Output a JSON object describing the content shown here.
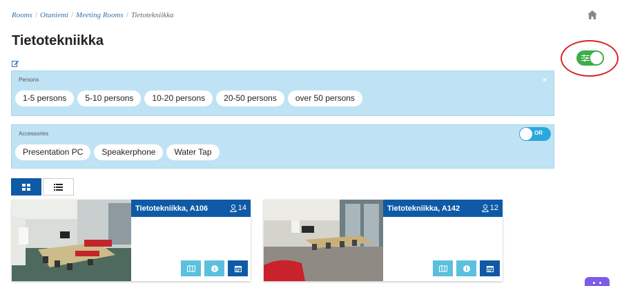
{
  "breadcrumb": {
    "items": [
      "Rooms",
      "Otaniemi",
      "Meeting Rooms"
    ],
    "current": "Tietotekniikka"
  },
  "page": {
    "title": "Tietotekniikka"
  },
  "filters": {
    "persons": {
      "label": "Persons",
      "close": "×",
      "options": [
        "1-5 persons",
        "5-10 persons",
        "10-20 persons",
        "20-50 persons",
        "over 50 persons"
      ]
    },
    "accessories": {
      "label": "Accessories",
      "toggle_label": "OR",
      "options": [
        "Presentation PC",
        "Speakerphone",
        "Water Tap"
      ]
    },
    "filter_toggle_on": true
  },
  "rooms": [
    {
      "name": "Tietotekniikka, A106",
      "capacity": "14"
    },
    {
      "name": "Tietotekniikka, A142",
      "capacity": "12"
    }
  ],
  "icons": {
    "home": "home-icon",
    "edit": "edit-icon",
    "grid_view": "grid-icon",
    "list_view": "list-icon",
    "capacity": "user-icon",
    "map": "map-icon",
    "info": "info-icon",
    "calendar": "calendar-icon"
  },
  "colors": {
    "primary": "#0f5aa6",
    "panel_bg": "#bfe3f4",
    "toggle_green": "#3fae49",
    "toggle_blue": "#2aa8dc",
    "action_light": "#5bc0de",
    "annotation": "#d8232a",
    "chat": "#7c5ce8"
  }
}
